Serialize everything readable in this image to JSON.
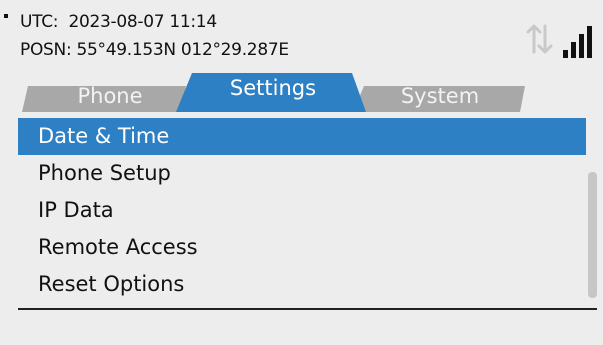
{
  "status": {
    "utc_label": "UTC:",
    "utc_value": "2023-08-07 11:14",
    "posn_label": "POSN:",
    "posn_value": "55°49.153N 012°29.287E",
    "transfer_icon": "up-down-arrows-icon",
    "signal_icon": "signal-bars-icon",
    "signal_level": "4 of 4 bars"
  },
  "tabs": [
    {
      "label": "Phone",
      "active": false
    },
    {
      "label": "Settings",
      "active": true
    },
    {
      "label": "System",
      "active": false
    }
  ],
  "menu": {
    "items": [
      {
        "label": "Date & Time",
        "selected": true
      },
      {
        "label": "Phone Setup",
        "selected": false
      },
      {
        "label": "IP Data",
        "selected": false
      },
      {
        "label": "Remote Access",
        "selected": false
      },
      {
        "label": "Reset Options",
        "selected": false
      }
    ]
  },
  "colors": {
    "accent": "#2e80c4",
    "inactive_tab": "#a8a8a8",
    "background": "#ededed"
  }
}
